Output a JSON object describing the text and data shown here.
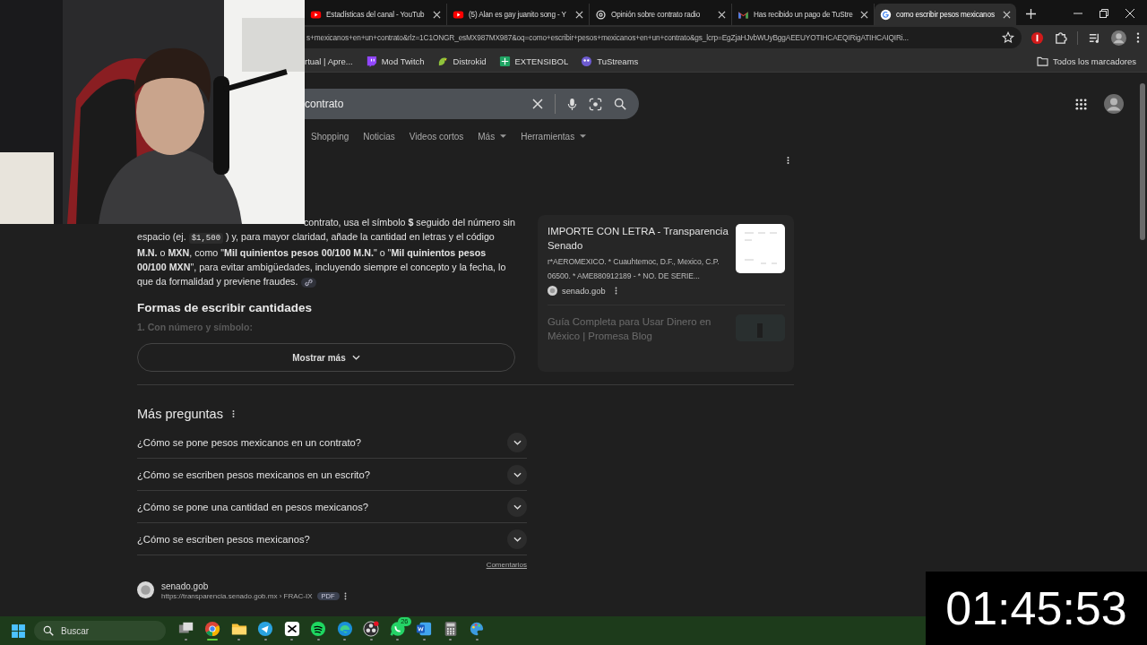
{
  "tabs": [
    {
      "title": "Estadísticas del canal - YouTub",
      "kind": "youtube",
      "selected": false
    },
    {
      "title": "(5) Alan es gay juanito song - Y",
      "kind": "youtube",
      "selected": false
    },
    {
      "title": "Opinión sobre contrato radio",
      "kind": "openai",
      "selected": false
    },
    {
      "title": "Has recibido un pago de TuStre",
      "kind": "gmail",
      "selected": false
    },
    {
      "title": "como escribir pesos mexicanos",
      "kind": "google",
      "selected": true
    }
  ],
  "address_bar": {
    "url": "s+mexicanos+en+un+contrato&rlz=1C1ONGR_esMX987MX987&oq=como+escribir+pesos+mexicanos+en+un+contrato&gs_lcrp=EgZjaHJvbWUyBggAEEUYOTIHCAEQIRigATIHCAIQIRi..."
  },
  "bookmarks": [
    {
      "label": "rtual | Apre...",
      "kind": "none"
    },
    {
      "label": "Mod Twitch",
      "kind": "twitch"
    },
    {
      "label": "Distrokid",
      "kind": "distrokid"
    },
    {
      "label": "EXTENSIBOL",
      "kind": "sheets"
    },
    {
      "label": "TuStreams",
      "kind": "tustreams"
    }
  ],
  "all_bookmarks": "Todos los marcadores",
  "search": {
    "value": "contrato"
  },
  "search_tabs": [
    {
      "label": "Shopping",
      "dropdown": false
    },
    {
      "label": "Noticias",
      "dropdown": false
    },
    {
      "label": "Videos cortos",
      "dropdown": false
    },
    {
      "label": "Más",
      "dropdown": true
    },
    {
      "label": "Herramientas",
      "dropdown": true
    }
  ],
  "answer": {
    "parts": [
      {
        "kind": "text",
        "text": "contrato, usa el símbolo **$** seguido del número sin espacio (ej. "
      },
      {
        "kind": "code",
        "text": "$1,500"
      },
      {
        "kind": "text",
        "text": " ) y, para mayor claridad, añade la cantidad en letras y el código **M.N.** o **MXN**, como \"**Mil quinientos pesos 00/100 M.N.**\" o \"**Mil quinientos pesos 00/100 MXN**\", para evitar ambigüedades, incluyendo siempre el concepto y la fecha, lo que da formalidad y previene fraudes."
      }
    ],
    "heading": "Formas de escribir cantidades",
    "list_item": "1. Con número y símbolo:",
    "more_button": "Mostrar más"
  },
  "sources": [
    {
      "title": "IMPORTE CON LETRA - Transparencia Senado",
      "snippet": "r*AEROMEXICO. * Cuauhtemoc, D.F., Mexico, C.P. 06500. * AME880912189 - * NO. DE SERIE...",
      "site": "senado.gob",
      "faded": false
    },
    {
      "title": "Guía Completa para Usar Dinero en México | Promesa Blog",
      "faded": true
    }
  ],
  "related": {
    "title": "Más preguntas",
    "questions": [
      "¿Cómo se pone pesos mexicanos en un contrato?",
      "¿Cómo se escriben pesos mexicanos en un escrito?",
      "¿Cómo se pone una cantidad en pesos mexicanos?",
      "¿Cómo se escriben pesos mexicanos?"
    ],
    "feedback": "Comentarios"
  },
  "result": {
    "site": "senado.gob",
    "url": "https://transparencia.senado.gob.mx › FRAC-IX",
    "badge": "PDF"
  },
  "taskbar": {
    "search_placeholder": "Buscar",
    "apps": [
      {
        "kind": "taskview",
        "active": false
      },
      {
        "kind": "chrome",
        "active": true
      },
      {
        "kind": "files",
        "active": false
      },
      {
        "kind": "telegram",
        "active": false
      },
      {
        "kind": "capcut",
        "active": false
      },
      {
        "kind": "spotify",
        "active": false
      },
      {
        "kind": "edge",
        "active": false
      },
      {
        "kind": "obs",
        "active": false
      },
      {
        "kind": "whatsapp",
        "active": false,
        "badge": "26"
      },
      {
        "kind": "word",
        "active": false
      },
      {
        "kind": "calculator",
        "active": false
      },
      {
        "kind": "paint",
        "active": false
      }
    ]
  },
  "timer": "01:45:53"
}
